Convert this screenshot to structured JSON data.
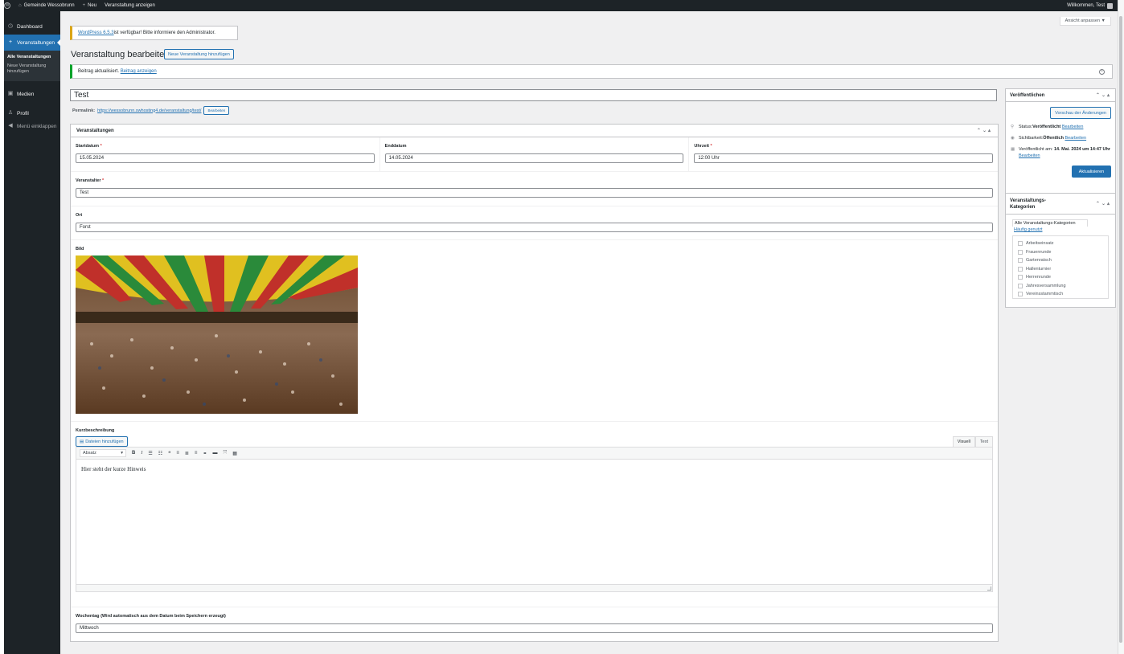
{
  "adminbar": {
    "site_name": "Gemeinde Wessobrunn",
    "new_label": "Neu",
    "view_label": "Veranstaltung anzeigen",
    "greeting": "Willkommen, Test"
  },
  "sidebar": {
    "items": [
      {
        "label": "Dashboard",
        "icon": "dashboard-icon"
      },
      {
        "label": "Veranstaltungen",
        "icon": "plus-icon"
      },
      {
        "label": "Medien",
        "icon": "media-icon"
      },
      {
        "label": "Profil",
        "icon": "user-icon"
      }
    ],
    "submenu": [
      "Alle Veranstaltungen",
      "Neue Veranstaltung hinzufügen"
    ],
    "collapse": "Menü einklappen"
  },
  "screen_options": "Ansicht anpassen ▼",
  "update_notice": {
    "link": "WordPress 6.5.3",
    "text": " ist verfügbar! Bitte informiere den Administrator."
  },
  "page": {
    "title": "Veranstaltung bearbeiten",
    "add_new": "Neue Veranstaltung hinzufügen"
  },
  "success_notice": {
    "text": "Beitrag aktualisiert. ",
    "link": "Beitrag anzeigen"
  },
  "post": {
    "title": "Test",
    "permalink_label": "Permalink:",
    "permalink_url": "https://wessobrunn.swhosting4.de/veranstaltung/test/",
    "edit_label": "Bearbeiten"
  },
  "metabox": {
    "title": "Veranstaltungen",
    "fields": {
      "start_label": "Startdatum",
      "start_value": "15.05.2024",
      "end_label": "Enddatum",
      "end_value": "14.05.2024",
      "time_label": "Uhrzeit",
      "time_value": "12:00 Uhr",
      "organizer_label": "Veranstalter",
      "organizer_value": "Test",
      "place_label": "Ort",
      "place_value": "Forst",
      "image_label": "Bild",
      "desc_label": "Kurzbeschreibung",
      "add_media": "Dateien hinzufügen",
      "tab_visual": "Visuell",
      "tab_text": "Text",
      "format": "Absatz",
      "desc_text": "Hier steht der kurze Hinweis",
      "weekday_label": "Wochentag (Wird automatisch aus dem Datum beim Speichern erzeugt)",
      "weekday_value": "Mittwoch"
    }
  },
  "publish": {
    "title": "Veröffentlichen",
    "preview": "Vorschau der Änderungen",
    "status_label": "Status: ",
    "status_value": "Veröffentlicht",
    "visibility_label": "Sichtbarkeit: ",
    "visibility_value": "Öffentlich",
    "published_label": "Veröffentlicht am: ",
    "published_value": "14. Mai. 2024 um 14:47 Uhr",
    "edit": "Bearbeiten",
    "update": "Aktualisieren"
  },
  "categories": {
    "title": "Veranstaltungs-Kategorien",
    "tab_all": "Alle Veranstaltungs-Kategorien",
    "tab_used": "Häufig genutzt",
    "items": [
      "Arbeitseinsatz",
      "Frauenrunde",
      "Gartenratsch",
      "Hallenturnier",
      "Herrenrunde",
      "Jahresversammlung",
      "Vereinsstammtisch"
    ]
  }
}
